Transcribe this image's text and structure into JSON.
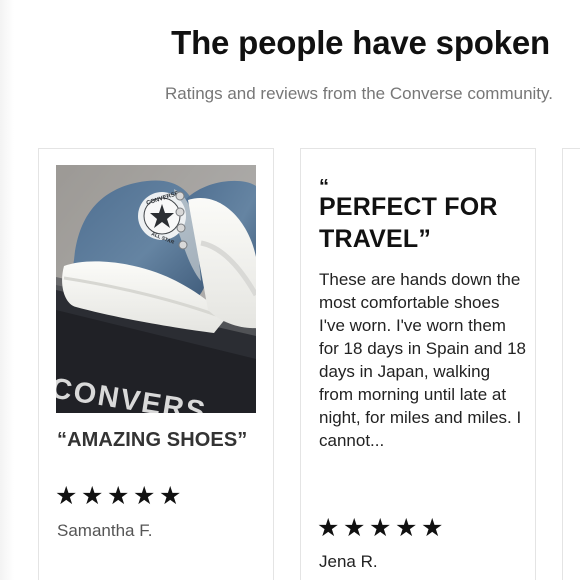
{
  "header": {
    "title": "The people have spoken",
    "subtitle": "Ratings and reviews from the Converse community."
  },
  "reviews": [
    {
      "image_description_icon": "converse-high-top-shoe-photo",
      "title": "“AMAZING SHOES”",
      "stars": [
        "★",
        "★",
        "★",
        "★",
        "★"
      ],
      "rating": 5,
      "author": "Samantha F.",
      "box_text": "CONVERS"
    },
    {
      "quote_mark": "“",
      "title": "PERFECT FOR TRAVEL”",
      "body": "These are hands down the most comfortable shoes I've worn. I've worn them for 18 days in Spain and 18 days in Japan, walking from morning until late at night, for miles and miles. I cannot...",
      "stars": [
        "★",
        "★",
        "★",
        "★",
        "★"
      ],
      "rating": 5,
      "author": "Jena R."
    }
  ],
  "colors": {
    "title": "#111111",
    "subtitle": "#777777",
    "card_border": "#e4e4e4",
    "shoe_denim": "#5f7f9f"
  }
}
